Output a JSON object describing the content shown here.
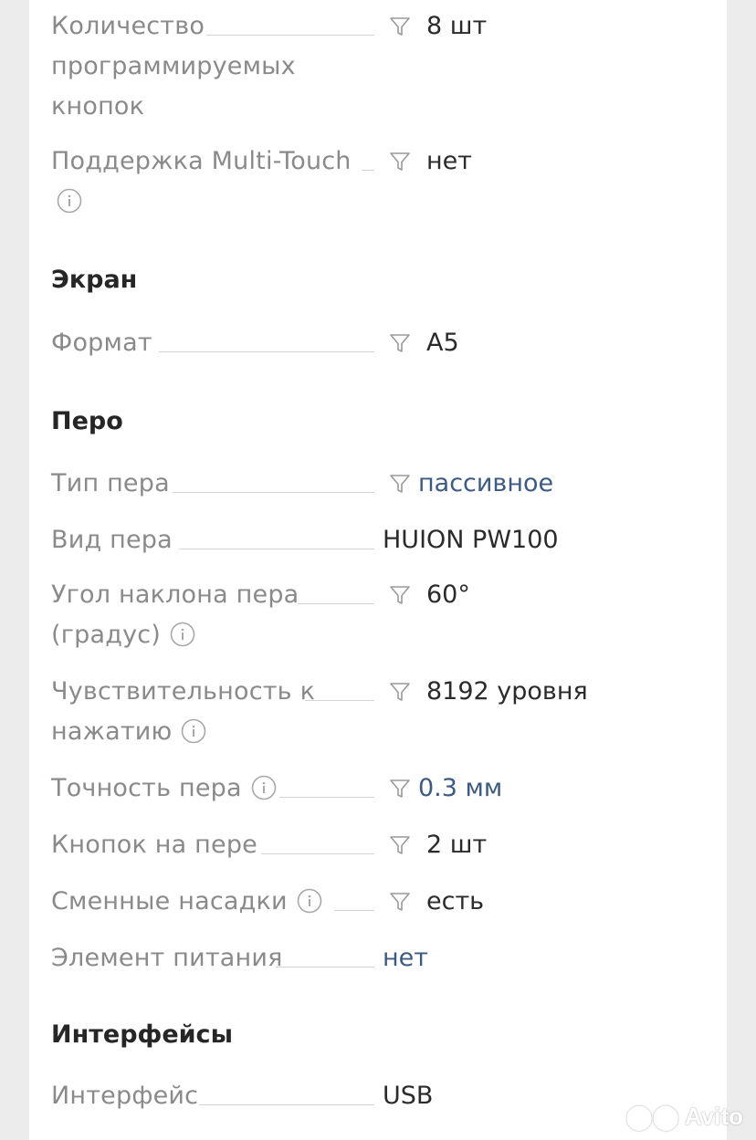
{
  "colors": {
    "label": "#8a8a8a",
    "value": "#2b2b2b",
    "link": "#3d5a80",
    "heading": "#262626"
  },
  "rows_top": [
    {
      "label_line1": "Количество",
      "label_line2": "программируемых",
      "label_line3": "кнопок",
      "value": "8 шт"
    },
    {
      "label_line1": "Поддержка Multi-Touch",
      "value": "нет"
    }
  ],
  "sections": {
    "screen": "Экран",
    "pen": "Перо",
    "interfaces": "Интерфейсы"
  },
  "screen_rows": [
    {
      "label": "Формат",
      "value": "A5"
    }
  ],
  "pen_rows": [
    {
      "label": "Тип пера",
      "value": "пассивное"
    },
    {
      "label": "Вид пера",
      "value": "HUION PW100"
    },
    {
      "label_line1": "Угол наклона пера",
      "label_line2": "(градус)",
      "value": "60°"
    },
    {
      "label_line1": "Чувствительность к",
      "label_line2": "нажатию",
      "value": "8192 уровня"
    },
    {
      "label": "Точность пера",
      "value": "0.3 мм"
    },
    {
      "label": "Кнопок на пере",
      "value": "2 шт"
    },
    {
      "label": "Сменные насадки",
      "value": "есть"
    },
    {
      "label": "Элемент питания",
      "value": "нет"
    }
  ],
  "interface_rows": [
    {
      "label": "Интерфейс",
      "value": "USB"
    }
  ],
  "watermark": "Avito",
  "icons": {
    "filter": "funnel-icon",
    "info": "info-circle-icon"
  }
}
